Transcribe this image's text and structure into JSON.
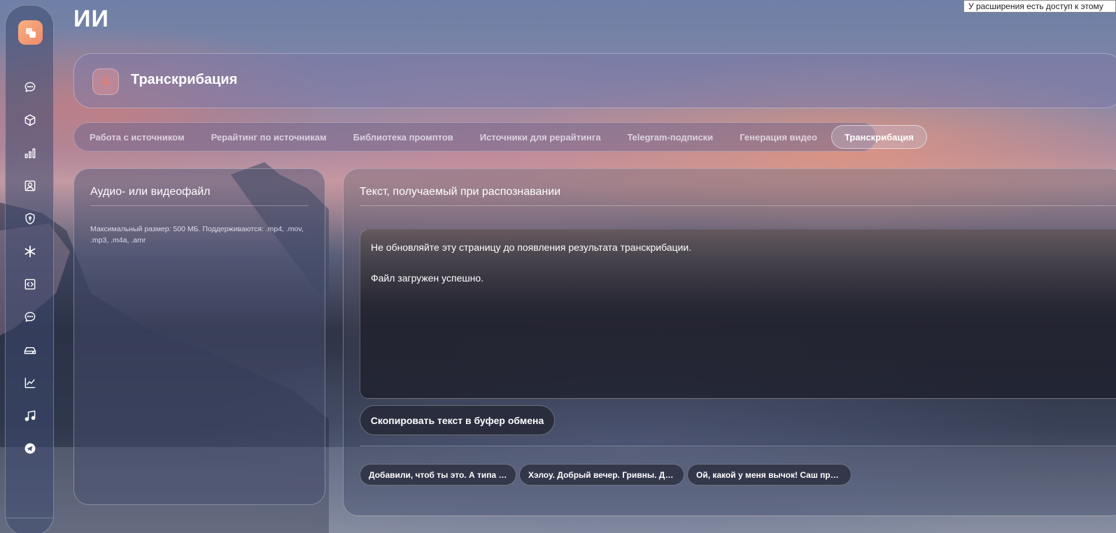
{
  "tooltip": "У расширения есть доступ к этому",
  "app": {
    "title": "ИИ"
  },
  "sidebar": {
    "logo_icon": "logo-icon",
    "items": [
      {
        "icon": "chat-bubble-icon"
      },
      {
        "icon": "cube-icon"
      },
      {
        "icon": "bar-chart-icon"
      },
      {
        "icon": "portrait-icon"
      },
      {
        "icon": "shield-icon"
      },
      {
        "icon": "asterisk-icon"
      },
      {
        "icon": "code-icon"
      },
      {
        "icon": "chat-bubble-icon"
      },
      {
        "icon": "hdd-icon"
      },
      {
        "icon": "trend-chart-icon"
      },
      {
        "icon": "music-icon"
      },
      {
        "icon": "telegram-icon"
      }
    ]
  },
  "header": {
    "title": "Транскрибация",
    "icon": "microphone-icon"
  },
  "tabs": [
    {
      "label": "Работа с источником"
    },
    {
      "label": "Рерайтинг по источникам"
    },
    {
      "label": "Библиотека промптов"
    },
    {
      "label": "Источники для рерайтинга"
    },
    {
      "label": "Telegram-подписки"
    },
    {
      "label": "Генерация видео"
    },
    {
      "label": "Транскрибация",
      "active": true
    }
  ],
  "upload_panel": {
    "title": "Аудио- или видеофайл",
    "hint": "Максимальный размер: 500 МБ. Поддерживаются: .mp4, .mov, .mp3, .m4a, .amr"
  },
  "result_panel": {
    "title": "Текст, получаемый при распознавании",
    "lines": [
      "Не обновляйте эту страницу до появления результата транскрибации.",
      "Файл загружен успешно."
    ],
    "copy_button": "Скопировать текст в буфер обмена",
    "history": [
      "Добавили, чтоб ты это. А типа п...",
      "Хэлоу. Добрый вечер. Гривны. До...",
      "Ой, какой у меня вычок! Саш при..."
    ]
  },
  "colors": {
    "accent": "#f08a6c",
    "mic": "#f07a6a"
  }
}
